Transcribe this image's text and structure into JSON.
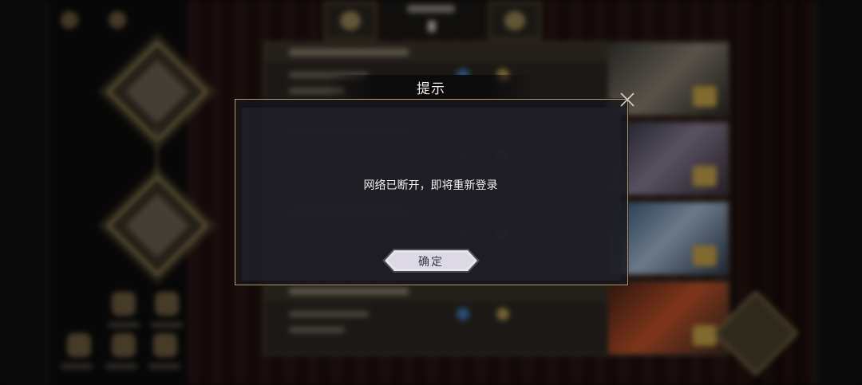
{
  "dialog": {
    "title": "提示",
    "message": "网络已断开，即将重新登录",
    "confirm_label": "确定",
    "close_icon": "close-icon"
  },
  "colors": {
    "dialog_border": "#b79f6f",
    "title_text": "#f2efe6",
    "button_fill": "#e3e0ea",
    "button_text": "#3a3744"
  }
}
